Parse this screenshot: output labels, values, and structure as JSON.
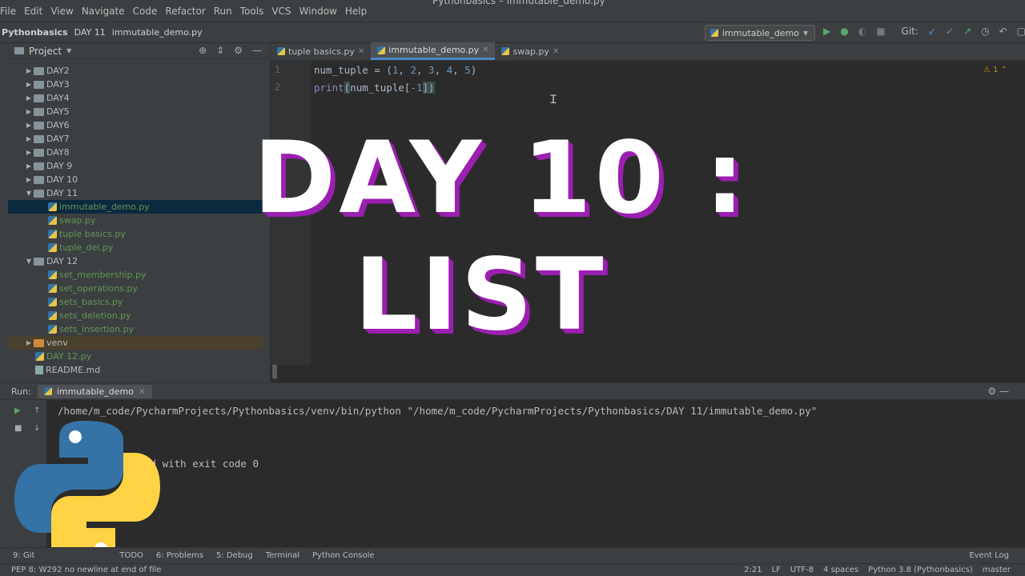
{
  "window_title": "Pythonbasics – immutable_demo.py",
  "menu": [
    "File",
    "Edit",
    "View",
    "Navigate",
    "Code",
    "Refactor",
    "Run",
    "Tools",
    "VCS",
    "Window",
    "Help"
  ],
  "breadcrumb": {
    "project": "Pythonbasics",
    "folder": "DAY 11",
    "file": "immutable_demo.py"
  },
  "run_config": "immutable_demo",
  "git_label": "Git:",
  "project_panel": {
    "title": "Project",
    "tree": [
      {
        "label": "DAY2",
        "kind": "folder",
        "expanded": false
      },
      {
        "label": "DAY3",
        "kind": "folder",
        "expanded": false
      },
      {
        "label": "DAY4",
        "kind": "folder",
        "expanded": false
      },
      {
        "label": "DAY5",
        "kind": "folder",
        "expanded": false
      },
      {
        "label": "DAY6",
        "kind": "folder",
        "expanded": false
      },
      {
        "label": "DAY7",
        "kind": "folder",
        "expanded": false
      },
      {
        "label": "DAY8",
        "kind": "folder",
        "expanded": false
      },
      {
        "label": "DAY 9",
        "kind": "folder",
        "expanded": false
      },
      {
        "label": "DAY 10",
        "kind": "folder",
        "expanded": false
      },
      {
        "label": "DAY 11",
        "kind": "folder",
        "expanded": true
      },
      {
        "label": "immutable_demo.py",
        "kind": "py",
        "selected": true
      },
      {
        "label": "swap.py",
        "kind": "py"
      },
      {
        "label": "tuple basics.py",
        "kind": "py"
      },
      {
        "label": "tuple_del.py",
        "kind": "py"
      },
      {
        "label": "DAY 12",
        "kind": "folder",
        "expanded": true
      },
      {
        "label": "set_membership.py",
        "kind": "py"
      },
      {
        "label": "set_operations.py",
        "kind": "py"
      },
      {
        "label": "sets_basics.py",
        "kind": "py"
      },
      {
        "label": "sets_deletion.py",
        "kind": "py"
      },
      {
        "label": "sets_insertion.py",
        "kind": "py"
      },
      {
        "label": "venv",
        "kind": "venv",
        "expanded": false
      },
      {
        "label": "DAY 12.py",
        "kind": "py"
      },
      {
        "label": "README.md",
        "kind": "md"
      }
    ]
  },
  "editor_tabs": [
    {
      "label": "tuple basics.py",
      "active": false
    },
    {
      "label": "immutable_demo.py",
      "active": true
    },
    {
      "label": "swap.py",
      "active": false
    }
  ],
  "code": {
    "line_numbers": [
      "1",
      "2"
    ],
    "line1": {
      "var": "num_tuple",
      "rest": " = (",
      "n1": "1",
      "n2": "2",
      "n3": "3",
      "n4": "4",
      "n5": "5",
      "end": ")"
    },
    "line2": {
      "fn": "print",
      "open": "(",
      "arg": "num_tuple[",
      "idx": "-1",
      "close": "])"
    },
    "inspection": "⚠ 1 ⌃"
  },
  "overlay": {
    "line1": "DAY 10 :",
    "line2": "LIST"
  },
  "run_panel": {
    "label": "Run:",
    "tab": "immutable_demo",
    "command": "/home/m_code/PycharmProjects/Pythonbasics/venv/bin/python \"/home/m_code/PycharmProjects/Pythonbasics/DAY 11/immutable_demo.py\"",
    "exit_message": "ed with exit code 0"
  },
  "bottom_tools": [
    "9: Git",
    "TODO",
    "6: Problems",
    "5: Debug",
    "Terminal",
    "Python Console"
  ],
  "event_log": "Event Log",
  "status": {
    "message": "PEP 8: W292 no newline at end of file",
    "position": "2:21",
    "line_sep": "LF",
    "encoding": "UTF-8",
    "indent": "4 spaces",
    "interpreter": "Python 3.8 (Pythonbasics)",
    "branch": "master"
  },
  "colors": {
    "accent_blue": "#4a88c7",
    "title_outline": "#9b1fb0",
    "python_blue": "#3572a5",
    "python_yellow": "#ffd343"
  }
}
